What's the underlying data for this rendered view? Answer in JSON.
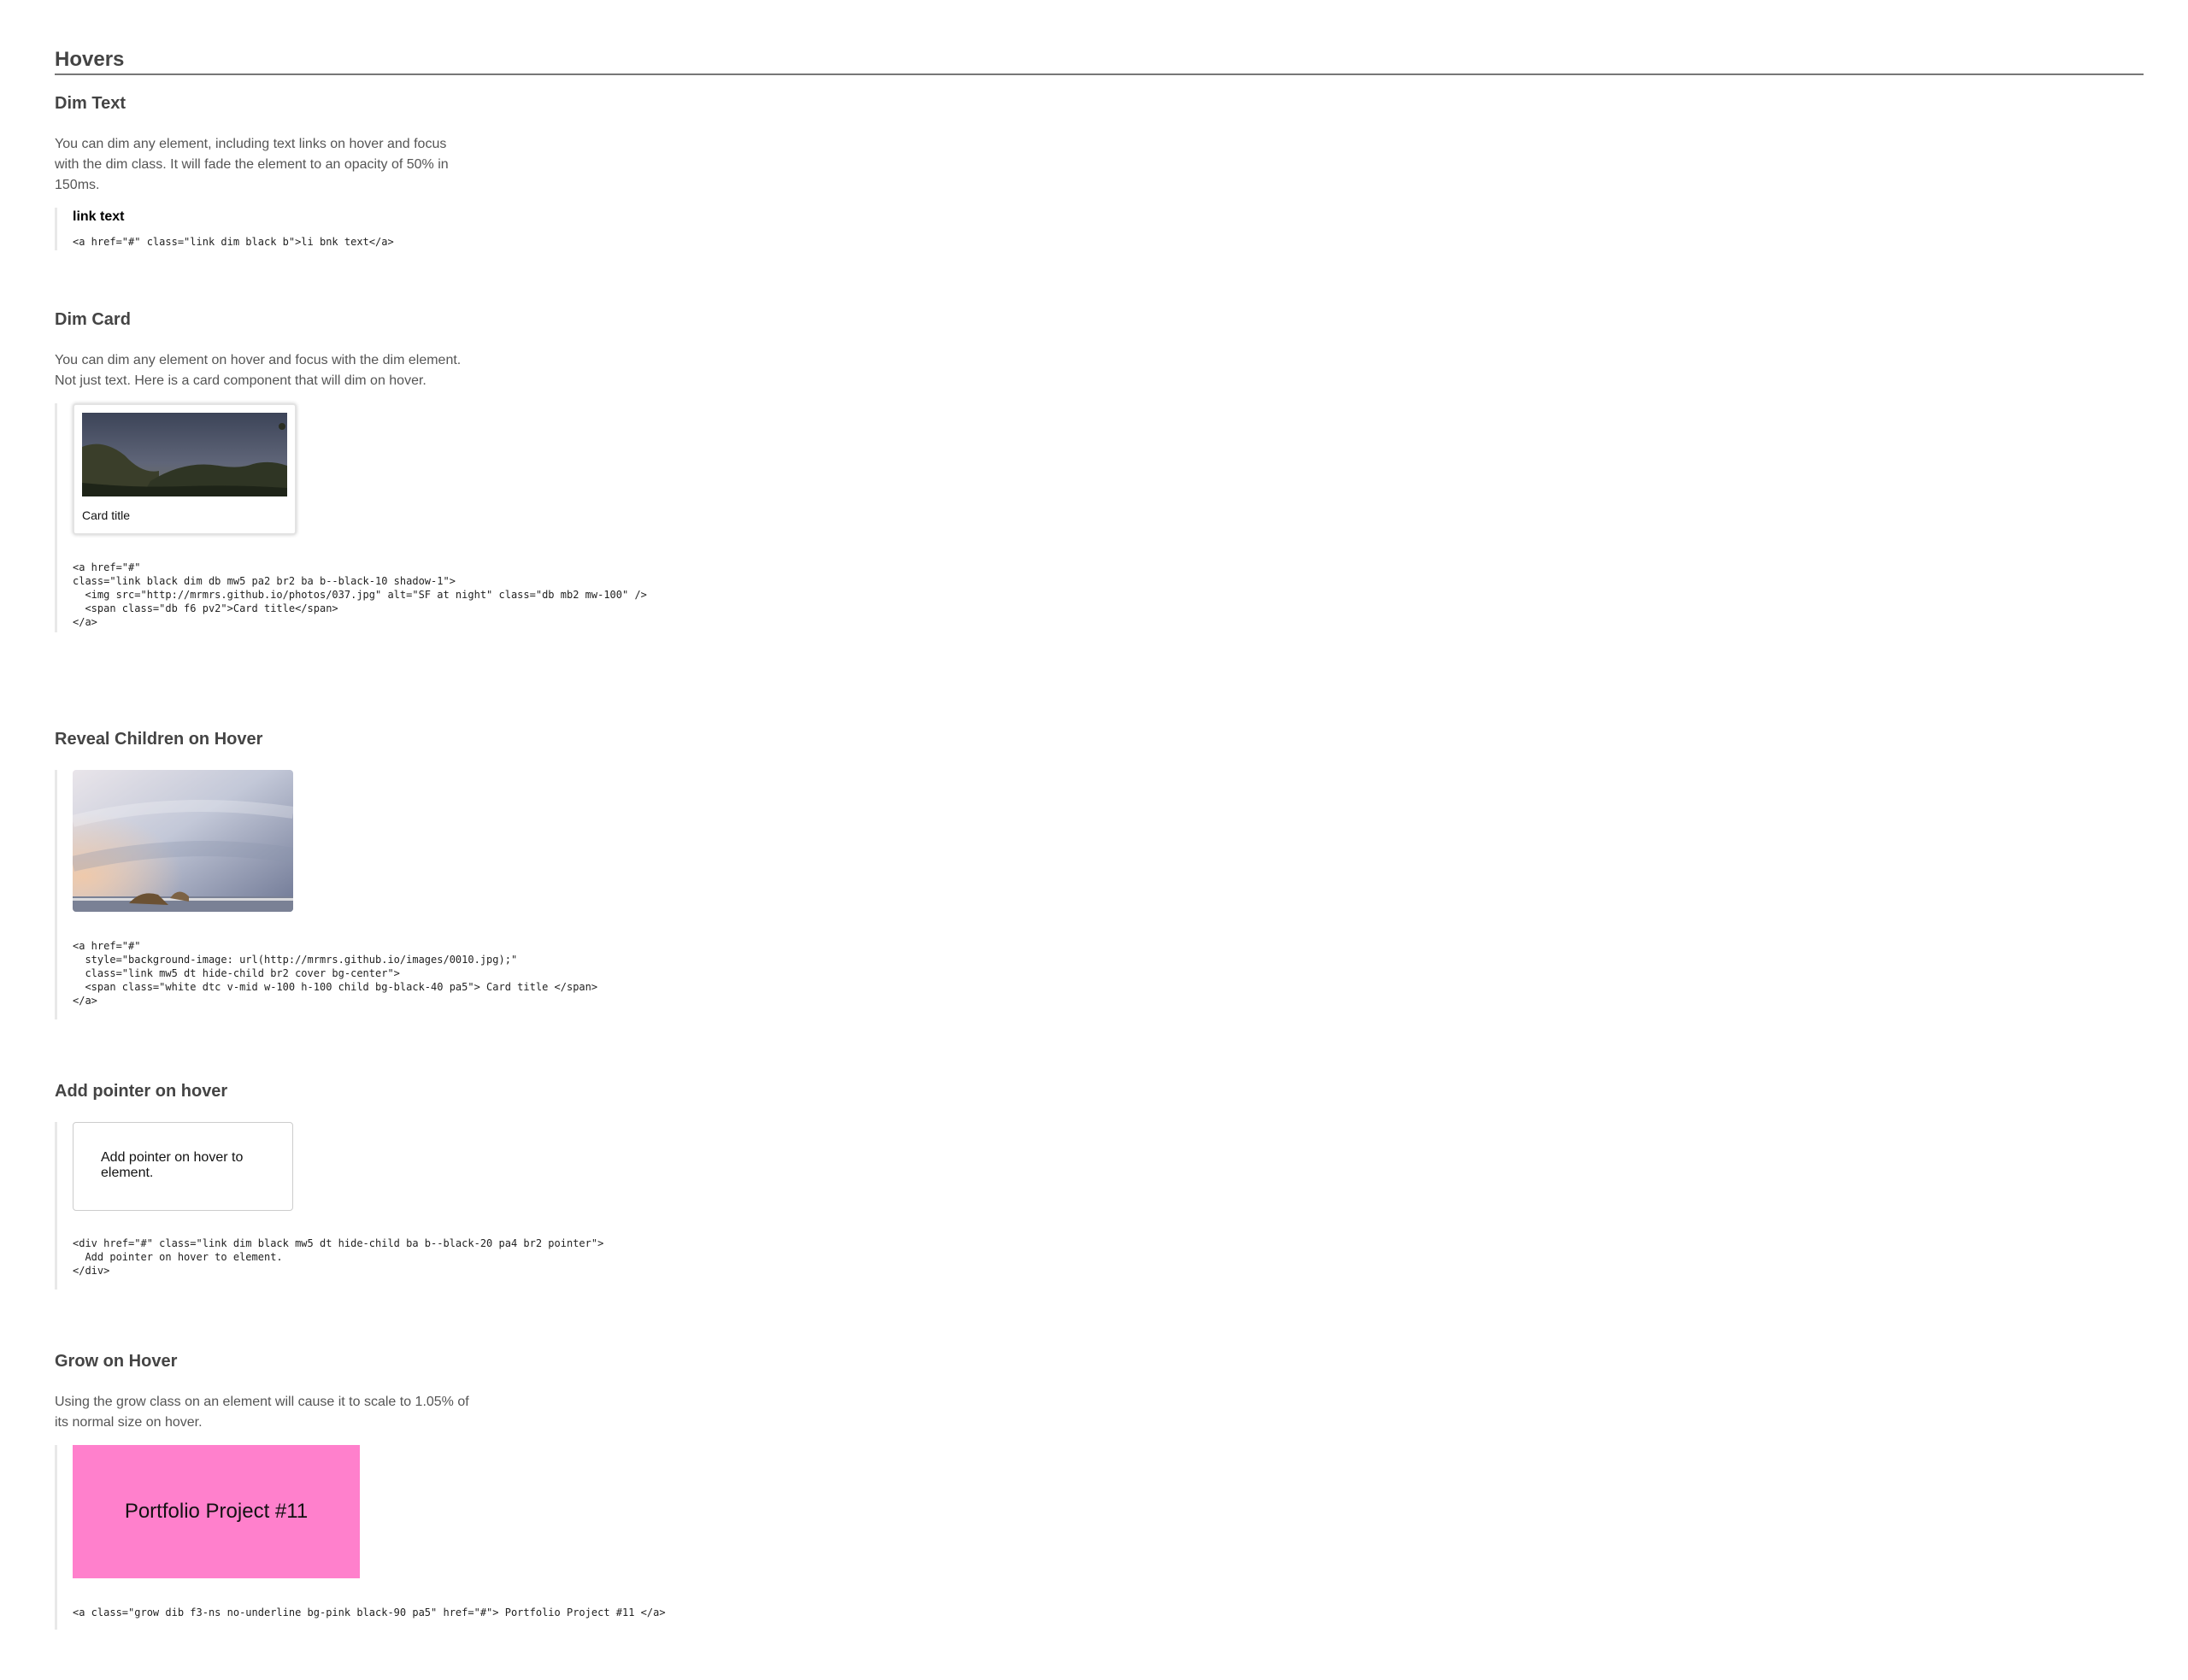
{
  "page_title": "Hovers",
  "dim_text": {
    "heading": "Dim Text",
    "description": "You can dim any element, including text links on hover and focus with the dim class. It will fade the element to an opacity of 50% in 150ms.",
    "link_label": "link text",
    "code": "<a href=\"#\" class=\"link dim black b\">li bnk text</a>"
  },
  "dim_card": {
    "heading": "Dim Card",
    "description": "You can dim any element on hover and focus with the dim element. Not just text. Here is a card component that will dim on hover.",
    "card_title": "Card title",
    "image_alt": "SF at night",
    "code": "<a href=\"#\"\nclass=\"link black dim db mw5 pa2 br2 ba b--black-10 shadow-1\">\n  <img src=\"http://mrmrs.github.io/photos/037.jpg\" alt=\"SF at night\" class=\"db mb2 mw-100\" />\n  <span class=\"db f6 pv2\">Card title</span>\n</a>"
  },
  "reveal": {
    "heading": "Reveal Children on Hover",
    "code": "<a href=\"#\"\n  style=\"background-image: url(http://mrmrs.github.io/images/0010.jpg);\"\n  class=\"link mw5 dt hide-child br2 cover bg-center\">\n  <span class=\"white dtc v-mid w-100 h-100 child bg-black-40 pa5\"> Card title </span>\n</a>"
  },
  "pointer": {
    "heading": "Add pointer on hover",
    "box_text": "Add pointer on hover to element.",
    "code": "<div href=\"#\" class=\"link dim black mw5 dt hide-child ba b--black-20 pa4 br2 pointer\">\n  Add pointer on hover to element.\n</div>"
  },
  "grow": {
    "heading": "Grow on Hover",
    "description": "Using the grow class on an element will cause it to scale to 1.05% of its normal size on hover.",
    "box_text": "Portfolio Project #11",
    "code": "<a class=\"grow dib f3-ns no-underline bg-pink black-90 pa5\" href=\"#\"> Portfolio Project #11 </a>"
  },
  "colors": {
    "pink": "#ff80cc",
    "rule": "#777777"
  }
}
